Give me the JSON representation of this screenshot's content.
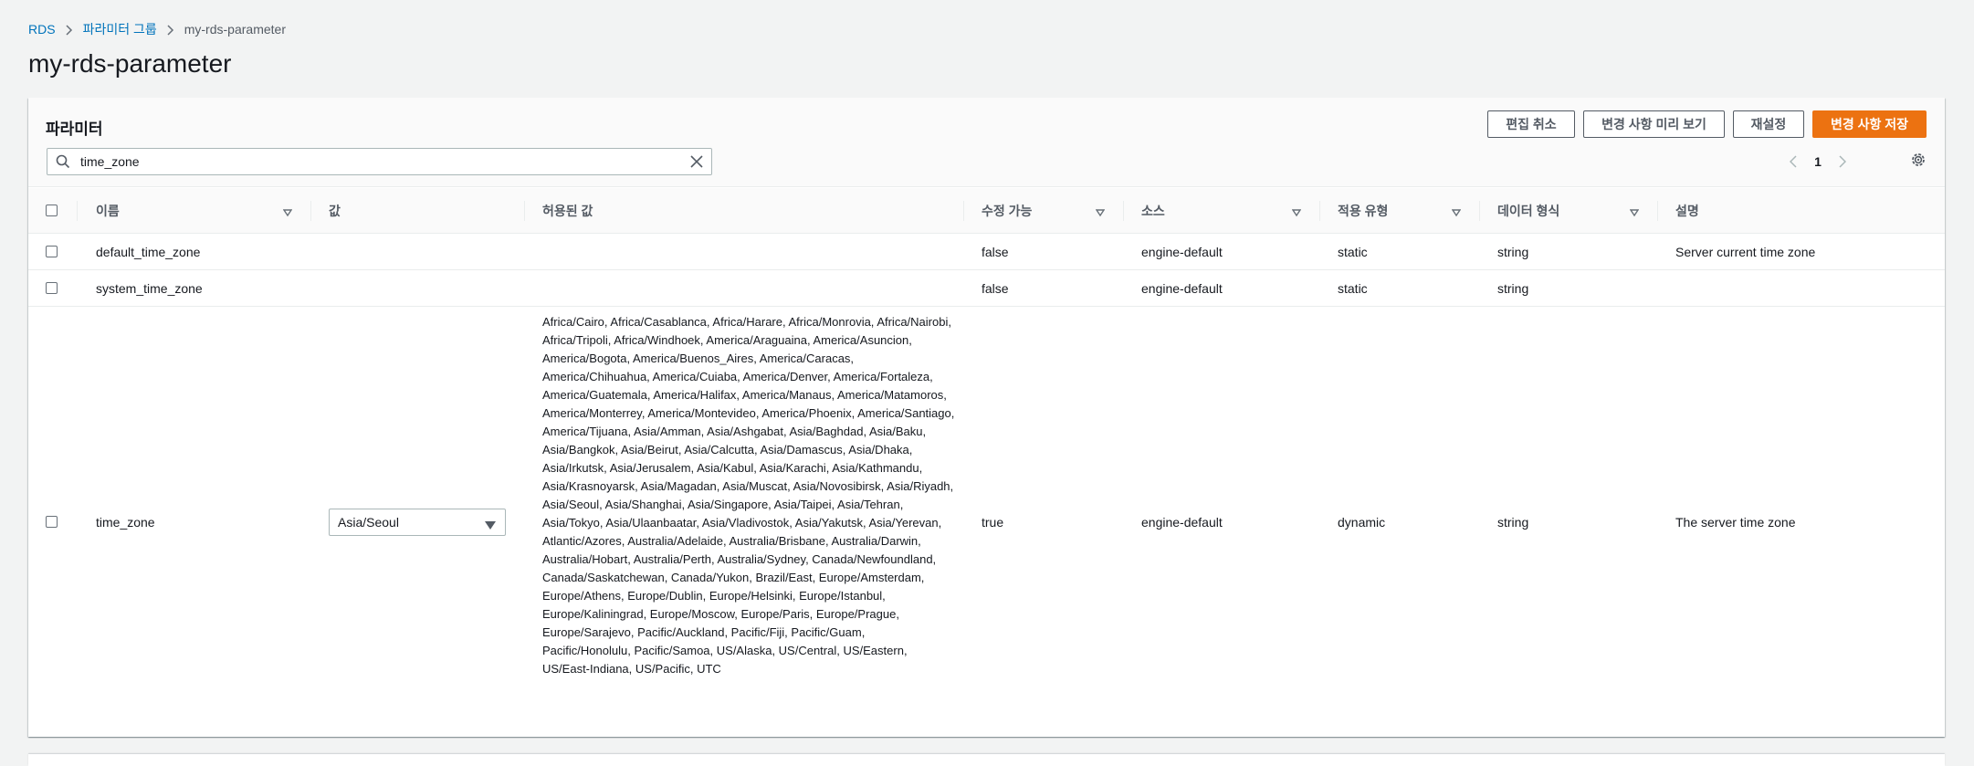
{
  "breadcrumb": {
    "items": [
      "RDS",
      "파라미터 그룹",
      "my-rds-parameter"
    ]
  },
  "page": {
    "title": "my-rds-parameter"
  },
  "panel": {
    "title": "파라미터",
    "buttons": {
      "cancel": "편집 취소",
      "preview": "변경 사항 미리 보기",
      "reset": "재설정",
      "save": "변경 사항 저장"
    },
    "search": {
      "value": "time_zone"
    },
    "pagination": {
      "current_page": "1"
    }
  },
  "table": {
    "columns": {
      "name": "이름",
      "value": "값",
      "allowed": "허용된 값",
      "modifiable": "수정 가능",
      "source": "소스",
      "apply_type": "적용 유형",
      "data_type": "데이터 형식",
      "description": "설명"
    },
    "rows": [
      {
        "name": "default_time_zone",
        "value": "",
        "allowed": "",
        "modifiable": "false",
        "source": "engine-default",
        "apply_type": "static",
        "data_type": "string",
        "description": "Server current time zone"
      },
      {
        "name": "system_time_zone",
        "value": "",
        "allowed": "",
        "modifiable": "false",
        "source": "engine-default",
        "apply_type": "static",
        "data_type": "string",
        "description": ""
      },
      {
        "name": "time_zone",
        "value": "Asia/Seoul",
        "allowed": "Africa/Cairo, Africa/Casablanca, Africa/Harare, Africa/Monrovia, Africa/Nairobi, Africa/Tripoli, Africa/Windhoek, America/Araguaina, America/Asuncion, America/Bogota, America/Buenos_Aires, America/Caracas, America/Chihuahua, America/Cuiaba, America/Denver, America/Fortaleza, America/Guatemala, America/Halifax, America/Manaus, America/Matamoros, America/Monterrey, America/Montevideo, America/Phoenix, America/Santiago, America/Tijuana, Asia/Amman, Asia/Ashgabat, Asia/Baghdad, Asia/Baku, Asia/Bangkok, Asia/Beirut, Asia/Calcutta, Asia/Damascus, Asia/Dhaka, Asia/Irkutsk, Asia/Jerusalem, Asia/Kabul, Asia/Karachi, Asia/Kathmandu, Asia/Krasnoyarsk, Asia/Magadan, Asia/Muscat, Asia/Novosibirsk, Asia/Riyadh, Asia/Seoul, Asia/Shanghai, Asia/Singapore, Asia/Taipei, Asia/Tehran, Asia/Tokyo, Asia/Ulaanbaatar, Asia/Vladivostok, Asia/Yakutsk, Asia/Yerevan, Atlantic/Azores, Australia/Adelaide, Australia/Brisbane, Australia/Darwin, Australia/Hobart, Australia/Perth, Australia/Sydney, Canada/Newfoundland, Canada/Saskatchewan, Canada/Yukon, Brazil/East, Europe/Amsterdam, Europe/Athens, Europe/Dublin, Europe/Helsinki, Europe/Istanbul, Europe/Kaliningrad, Europe/Moscow, Europe/Paris, Europe/Prague, Europe/Sarajevo, Pacific/Auckland, Pacific/Fiji, Pacific/Guam, Pacific/Honolulu, Pacific/Samoa, US/Alaska, US/Central, US/Eastern, US/East-Indiana, US/Pacific, UTC",
        "modifiable": "true",
        "source": "engine-default",
        "apply_type": "dynamic",
        "data_type": "string",
        "description": "The server time zone"
      }
    ]
  },
  "colors": {
    "link": "#0073bb",
    "primary_button": "#ec7211",
    "background": "#f2f3f3"
  },
  "icons": [
    "chevron-right-icon",
    "search-icon",
    "close-icon",
    "chevron-left-icon",
    "gear-icon",
    "sort-icon",
    "caret-down-icon"
  ]
}
